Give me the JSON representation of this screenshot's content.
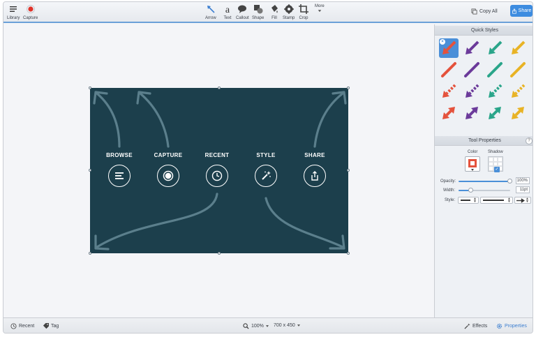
{
  "toolbar": {
    "library_label": "Library",
    "capture_label": "Capture",
    "tools": [
      {
        "label": "Arrow",
        "icon": "arrow-tool-icon"
      },
      {
        "label": "Text",
        "icon": "text-tool-icon"
      },
      {
        "label": "Callout",
        "icon": "callout-tool-icon"
      },
      {
        "label": "Shape",
        "icon": "shape-tool-icon"
      },
      {
        "label": "Fill",
        "icon": "fill-tool-icon"
      },
      {
        "label": "Stamp",
        "icon": "stamp-tool-icon"
      },
      {
        "label": "Crop",
        "icon": "crop-tool-icon"
      }
    ],
    "more_label": "More",
    "copy_all_label": "Copy All",
    "share_label": "Share"
  },
  "canvas": {
    "image_items": [
      {
        "label": "BROWSE",
        "icon": "list-icon"
      },
      {
        "label": "CAPTURE",
        "icon": "record-icon"
      },
      {
        "label": "RECENT",
        "icon": "clock-icon"
      },
      {
        "label": "STYLE",
        "icon": "magic-wand-icon"
      },
      {
        "label": "SHARE",
        "icon": "share-upload-icon"
      }
    ]
  },
  "panel": {
    "quick_styles_title": "Quick Styles",
    "tool_properties_title": "Tool Properties",
    "help_label": "?",
    "color_label": "Color",
    "shadow_label": "Shadow",
    "opacity_label": "Opacity:",
    "opacity_value": "100%",
    "opacity_fraction": 1.0,
    "width_label": "Width:",
    "width_value": "11pt",
    "width_fraction": 0.2,
    "style_label": "Style:",
    "style_colors": [
      "#e4523c",
      "#6b3a9a",
      "#2aa58a",
      "#e8b325"
    ],
    "selected_color": "#e4523c"
  },
  "statusbar": {
    "recent_label": "Recent",
    "tag_label": "Tag",
    "zoom_label": "100%",
    "size_label": "700 x 450",
    "effects_label": "Effects",
    "properties_label": "Properties"
  },
  "colors": {
    "accent": "#3d8ce0",
    "image_background": "#1c3f4c",
    "capture_red": "#e0332a"
  }
}
